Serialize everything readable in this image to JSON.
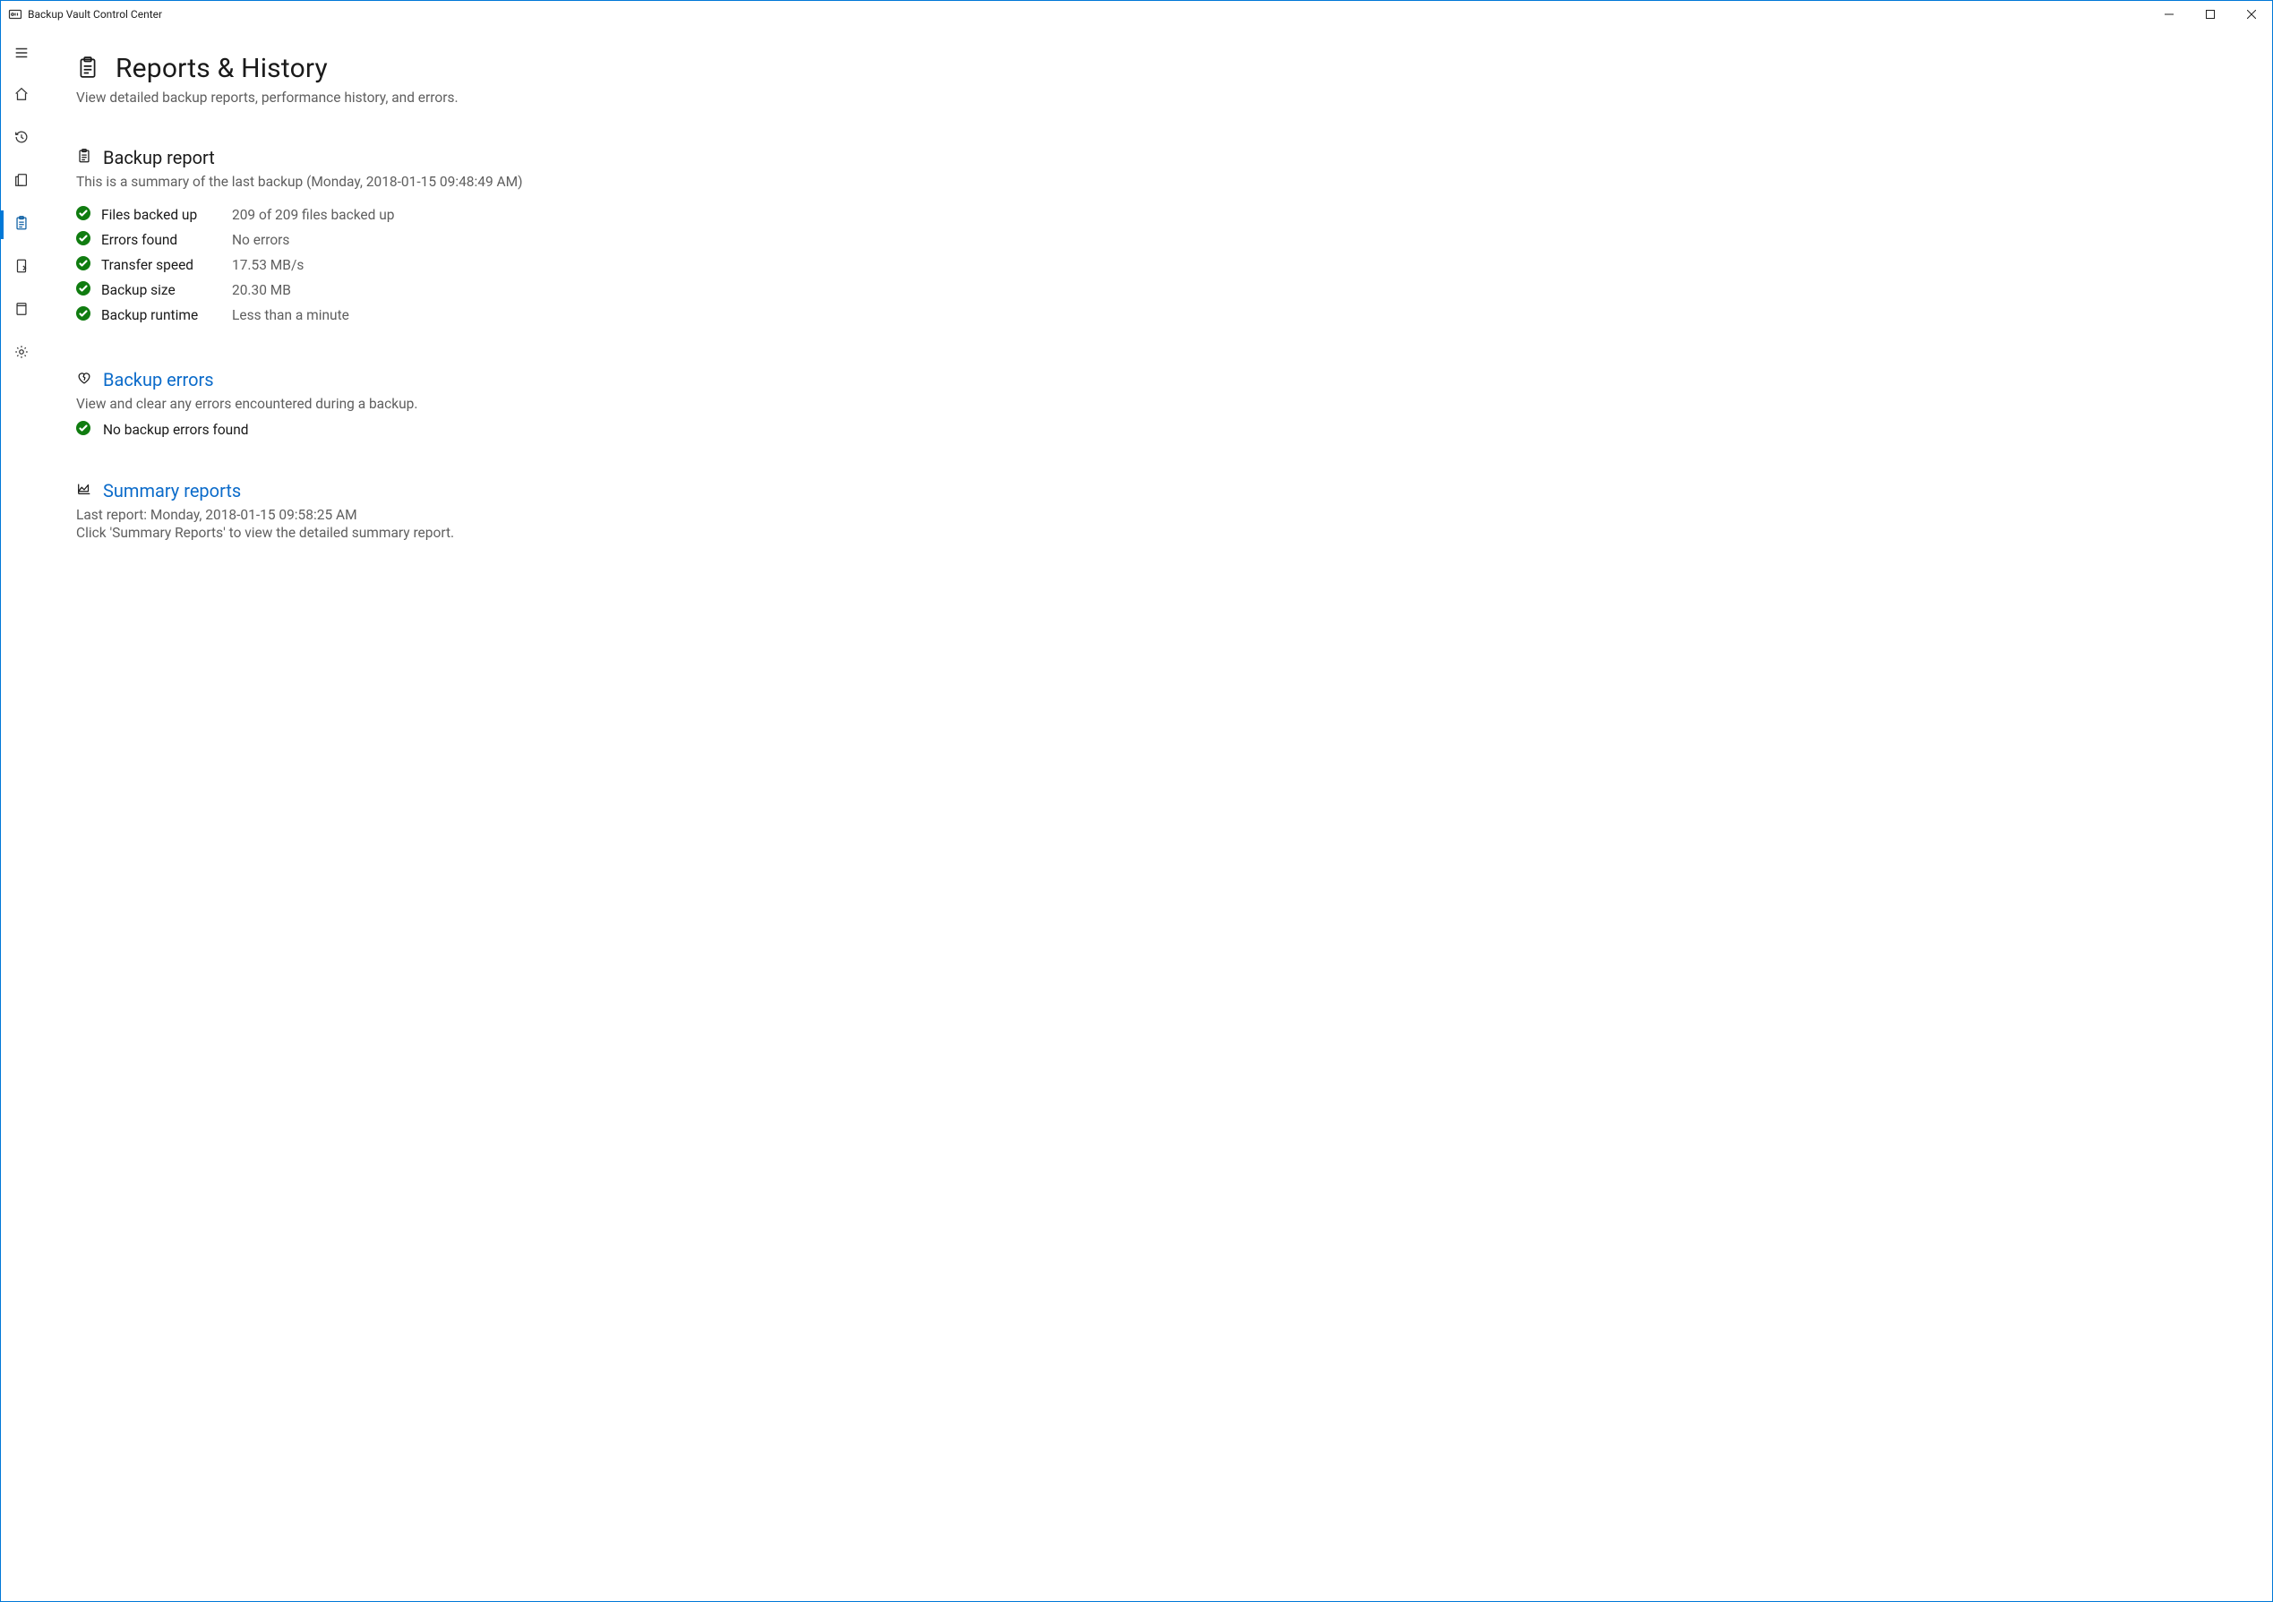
{
  "window": {
    "title": "Backup Vault Control Center"
  },
  "page": {
    "title": "Reports & History",
    "subtitle": "View detailed backup reports, performance history, and errors."
  },
  "backup_report": {
    "title": "Backup report",
    "subtitle": "This is a summary of the last backup (Monday, 2018-01-15 09:48:49 AM)",
    "rows": [
      {
        "label": "Files backed up",
        "value": "209 of 209 files backed up"
      },
      {
        "label": "Errors found",
        "value": "No errors"
      },
      {
        "label": "Transfer speed",
        "value": "17.53 MB/s"
      },
      {
        "label": "Backup size",
        "value": "20.30 MB"
      },
      {
        "label": "Backup runtime",
        "value": "Less than a minute"
      }
    ]
  },
  "backup_errors": {
    "title": "Backup errors",
    "subtitle": "View and clear any errors encountered during a backup.",
    "status": "No backup errors found"
  },
  "summary_reports": {
    "title": "Summary reports",
    "last_report": "Last report: Monday, 2018-01-15 09:58:25 AM",
    "hint": "Click 'Summary Reports' to view the detailed summary report."
  }
}
